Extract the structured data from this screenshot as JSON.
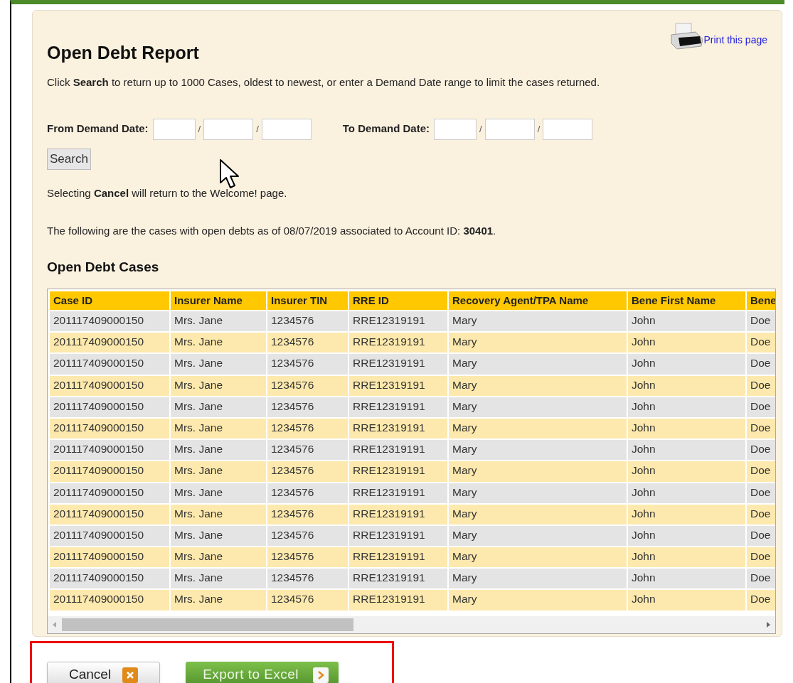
{
  "print_link": "Print this page",
  "title": "Open Debt Report",
  "instructions": "Click **Search** to return up to 1000 Cases, oldest to newest, or enter a Demand Date range to limit the cases returned.",
  "date_ranges": [
    {
      "label": "From Demand Date:",
      "separators": [
        "/",
        "/"
      ]
    },
    {
      "label": "To Demand Date:",
      "separators": [
        "/",
        "/"
      ]
    }
  ],
  "search_button": "Search",
  "cancel_note": "Selecting **Cancel** will return to the Welcome! page.",
  "summary": "The following are the cases with open debts as of 08/07/2019 associated to Account ID: **30401**.",
  "table": {
    "title": "Open Debt Cases",
    "columns": [
      "Case ID",
      "Insurer Name",
      "Insurer TIN",
      "RRE ID",
      "Recovery Agent/TPA Name",
      "Bene First Name",
      "Bene"
    ],
    "rows": [
      [
        "201117409000150",
        "Mrs. Jane",
        "1234576",
        "RRE12319191",
        "Mary",
        "John",
        "Doe"
      ],
      [
        "201117409000150",
        "Mrs. Jane",
        "1234576",
        "RRE12319191",
        "Mary",
        "John",
        "Doe"
      ],
      [
        "201117409000150",
        "Mrs. Jane",
        "1234576",
        "RRE12319191",
        "Mary",
        "John",
        "Doe"
      ],
      [
        "201117409000150",
        "Mrs. Jane",
        "1234576",
        "RRE12319191",
        "Mary",
        "John",
        "Doe"
      ],
      [
        "201117409000150",
        "Mrs. Jane",
        "1234576",
        "RRE12319191",
        "Mary",
        "John",
        "Doe"
      ],
      [
        "201117409000150",
        "Mrs. Jane",
        "1234576",
        "RRE12319191",
        "Mary",
        "John",
        "Doe"
      ],
      [
        "201117409000150",
        "Mrs. Jane",
        "1234576",
        "RRE12319191",
        "Mary",
        "John",
        "Doe"
      ],
      [
        "201117409000150",
        "Mrs. Jane",
        "1234576",
        "RRE12319191",
        "Mary",
        "John",
        "Doe"
      ],
      [
        "201117409000150",
        "Mrs. Jane",
        "1234576",
        "RRE12319191",
        "Mary",
        "John",
        "Doe"
      ],
      [
        "201117409000150",
        "Mrs. Jane",
        "1234576",
        "RRE12319191",
        "Mary",
        "John",
        "Doe"
      ],
      [
        "201117409000150",
        "Mrs. Jane",
        "1234576",
        "RRE12319191",
        "Mary",
        "John",
        "Doe"
      ],
      [
        "201117409000150",
        "Mrs. Jane",
        "1234576",
        "RRE12319191",
        "Mary",
        "John",
        "Doe"
      ],
      [
        "201117409000150",
        "Mrs. Jane",
        "1234576",
        "RRE12319191",
        "Mary",
        "John",
        "Doe"
      ],
      [
        "201117409000150",
        "Mrs. Jane",
        "1234576",
        "RRE12319191",
        "Mary",
        "John",
        "Doe"
      ]
    ]
  },
  "buttons": [
    {
      "label": "Cancel",
      "kind": "cancel"
    },
    {
      "label": "Export to Excel",
      "kind": "export"
    }
  ]
}
